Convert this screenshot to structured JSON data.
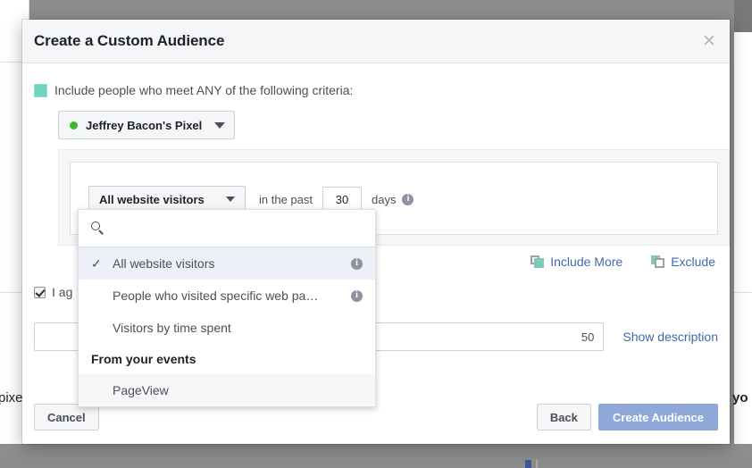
{
  "background": {
    "left_text": "pixe",
    "right_text": "yo"
  },
  "modal": {
    "title": "Create a Custom Audience",
    "close_icon": "close-icon",
    "criteria": {
      "label": "Include people who meet ANY of the following criteria:",
      "checkbox_color": "#6fd3bd"
    },
    "pixel_selector": {
      "name": "Jeffrey Bacon's Pixel",
      "status_dot_color": "#42b72a",
      "caret_icon": "chevron-down-icon"
    },
    "rule": {
      "type_label": "All website visitors",
      "caret_icon": "chevron-down-icon",
      "in_the_past": "in the past",
      "days_value": "30",
      "days_label": "days",
      "info_icon": "info-icon"
    },
    "links": {
      "include_more": "Include More",
      "exclude": "Exclude",
      "link_color": "#4267b2"
    },
    "agree": {
      "text": "I ag",
      "checked": true
    },
    "name_field": {
      "value": "50",
      "placeholder": ""
    },
    "show_description": "Show description",
    "footer": {
      "cancel": "Cancel",
      "back": "Back",
      "create": "Create Audience",
      "primary_color": "#8fa8d9"
    }
  },
  "dropdown": {
    "search_placeholder": "",
    "search_value": "",
    "search_icon": "search-icon",
    "items": [
      {
        "label": "All website visitors",
        "selected": true,
        "has_info": true
      },
      {
        "label": "People who visited specific web pa…",
        "selected": false,
        "has_info": true
      },
      {
        "label": "Visitors by time spent",
        "selected": false,
        "has_info": false
      }
    ],
    "group_label": "From your events",
    "events": [
      {
        "label": "PageView"
      }
    ],
    "check_glyph": "✓"
  }
}
